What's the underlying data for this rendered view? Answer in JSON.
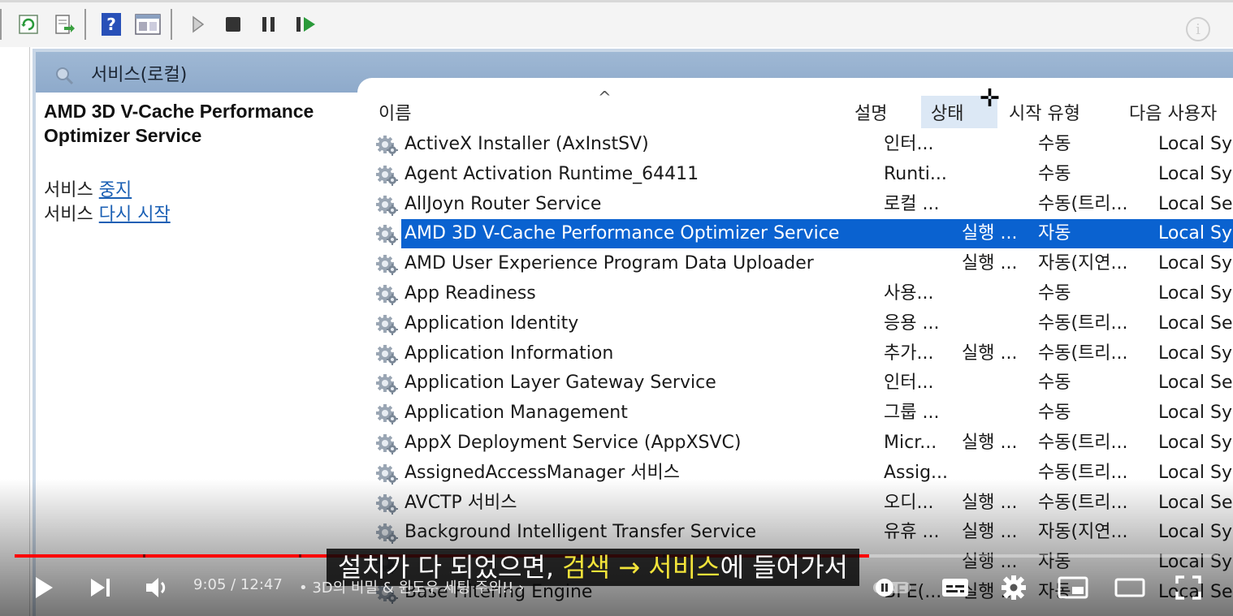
{
  "panel": {
    "title": "서비스(로컬)"
  },
  "detail": {
    "service_name": "AMD 3D V-Cache Performance Optimizer Service",
    "actions": [
      {
        "prefix": "서비스",
        "link": "중지"
      },
      {
        "prefix": "서비스",
        "link": "다시 시작"
      }
    ]
  },
  "columns": {
    "name": "이름",
    "desc": "설명",
    "status": "상태",
    "startup": "시작 유형",
    "logon": "다음 사용자"
  },
  "services": [
    {
      "name": "ActiveX Installer (AxInstSV)",
      "desc": "인터...",
      "status": "",
      "startup": "수동",
      "logon": "Local System"
    },
    {
      "name": "Agent Activation Runtime_64411",
      "desc": "Runti...",
      "status": "",
      "startup": "수동",
      "logon": "Local System"
    },
    {
      "name": "AllJoyn Router Service",
      "desc": "로컬 ...",
      "status": "",
      "startup": "수동(트리...",
      "logon": "Local Service"
    },
    {
      "name": "AMD 3D V-Cache Performance Optimizer Service",
      "desc": "",
      "status": "실행 ...",
      "startup": "자동",
      "logon": "Local System",
      "selected": true
    },
    {
      "name": "AMD User Experience Program Data Uploader",
      "desc": "",
      "status": "실행 ...",
      "startup": "자동(지연...",
      "logon": "Local System"
    },
    {
      "name": "App Readiness",
      "desc": "사용...",
      "status": "",
      "startup": "수동",
      "logon": "Local System"
    },
    {
      "name": "Application Identity",
      "desc": "응용 ...",
      "status": "",
      "startup": "수동(트리...",
      "logon": "Local Service"
    },
    {
      "name": "Application Information",
      "desc": "추가...",
      "status": "실행 ...",
      "startup": "수동(트리...",
      "logon": "Local System"
    },
    {
      "name": "Application Layer Gateway Service",
      "desc": "인터...",
      "status": "",
      "startup": "수동",
      "logon": "Local Service"
    },
    {
      "name": "Application Management",
      "desc": "그룹 ...",
      "status": "",
      "startup": "수동",
      "logon": "Local System"
    },
    {
      "name": "AppX Deployment Service (AppXSVC)",
      "desc": "Micr...",
      "status": "실행 ...",
      "startup": "수동(트리...",
      "logon": "Local System"
    },
    {
      "name": "AssignedAccessManager 서비스",
      "desc": "Assig...",
      "status": "",
      "startup": "수동(트리...",
      "logon": "Local System"
    },
    {
      "name": "AVCTP 서비스",
      "desc": "오디...",
      "status": "실행 ...",
      "startup": "수동(트리...",
      "logon": "Local Service"
    },
    {
      "name": "Background Intelligent Transfer Service",
      "desc": "유휴 ...",
      "status": "실행 ...",
      "startup": "자동(지연...",
      "logon": "Local System"
    },
    {
      "name": "",
      "desc": "",
      "status": "실행 ...",
      "startup": "자동",
      "logon": "Local System"
    },
    {
      "name": "Base Filtering Engine",
      "desc": "BFE(...",
      "status": "실행 ...",
      "startup": "자동",
      "logon": "Local Service"
    }
  ],
  "video": {
    "time": "9:05 / 12:47",
    "title": "• 3D의 비밀 & 윈도우 세팅 주의!!",
    "progress": 0.71,
    "caption_parts": [
      {
        "text": "설치가 다 되었으면, ",
        "hl": false
      },
      {
        "text": "검색 → 서비스",
        "hl": true
      },
      {
        "text": "에 들어가서",
        "hl": false
      }
    ]
  }
}
